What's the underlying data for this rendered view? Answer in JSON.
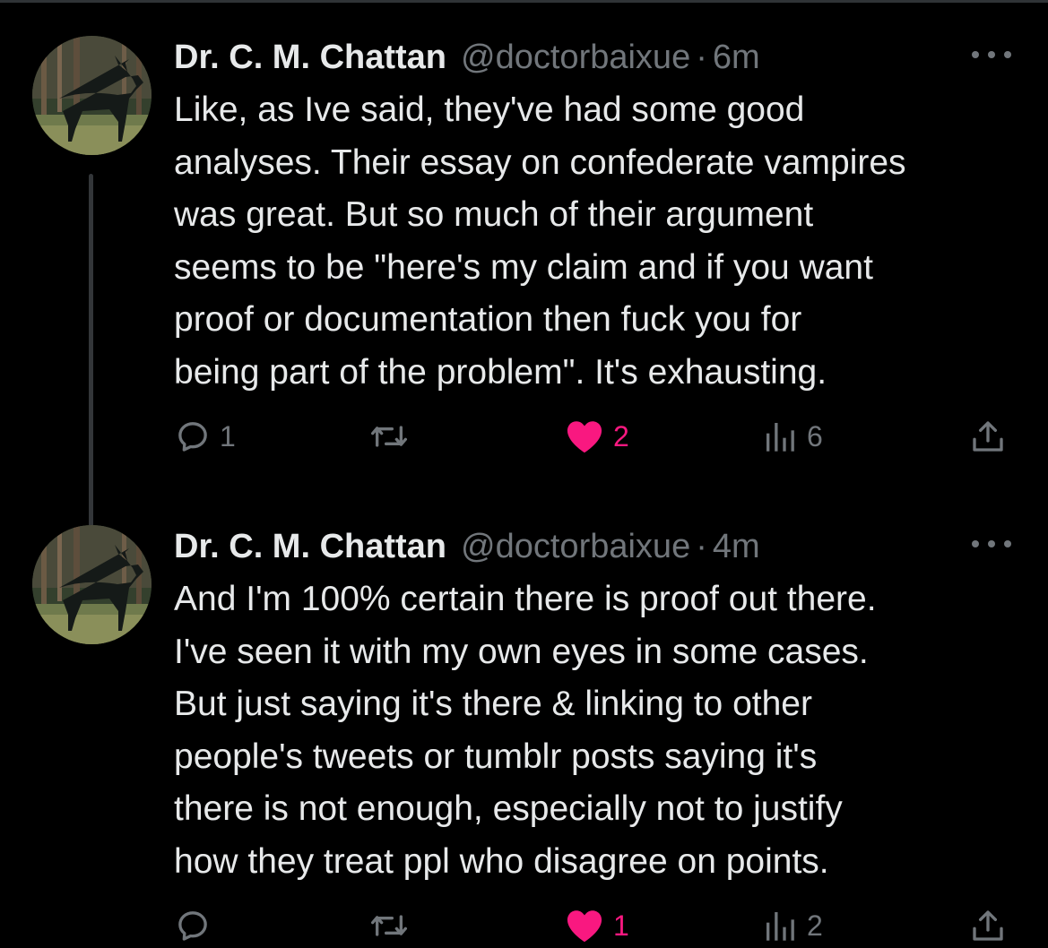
{
  "tweets": [
    {
      "author_name": "Dr. C. M. Chattan",
      "handle": "@doctorbaixue",
      "separator": "·",
      "time": "6m",
      "lines": [
        "Like, as Ive said, they've had some good",
        "analyses. Their essay on confederate vampires",
        "was great. But so much of their argument",
        "seems to be \"here's my claim and if you want",
        "proof or documentation then fuck you for",
        "being part of the problem\". It's exhausting."
      ],
      "stats": {
        "replies": "1",
        "retweets": "",
        "likes": "2",
        "views": "6"
      },
      "liked": true
    },
    {
      "author_name": "Dr. C. M. Chattan",
      "handle": "@doctorbaixue",
      "separator": "·",
      "time": "4m",
      "lines": [
        "And I'm 100% certain there is proof out there.",
        "I've seen it with my own eyes in some cases.",
        "But just saying it's there & linking to other",
        "people's tweets or tumblr posts saying it's",
        "there is not enough, especially not to justify",
        "how they treat ppl who disagree on points."
      ],
      "stats": {
        "replies": "",
        "retweets": "",
        "likes": "1",
        "views": "2"
      },
      "liked": true
    }
  ],
  "icons": {
    "avatar": "deer-in-forest-avatar",
    "more": "more-options-icon",
    "reply": "reply-icon",
    "retweet": "retweet-icon",
    "like": "heart-icon",
    "views": "views-chart-icon",
    "share": "share-icon"
  },
  "colors": {
    "background": "#000000",
    "text": "#e7e9ea",
    "secondary": "#71767b",
    "like": "#f91880",
    "divider": "#2f3336"
  }
}
